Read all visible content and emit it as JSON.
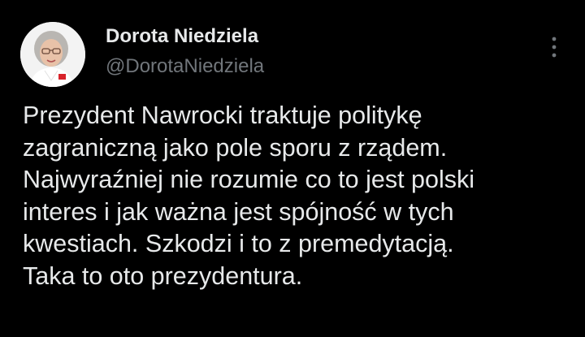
{
  "author": {
    "display_name": "Dorota Niedziela",
    "handle": "@DorotaNiedziela",
    "avatar_icon": "profile-photo"
  },
  "menu": {
    "icon": "more-vertical-icon"
  },
  "tweet": {
    "text": "Prezydent Nawrocki traktuje politykę\nzagraniczną jako pole sporu z rządem.\nNajwyraźniej nie rozumie co to jest polski\ninteres i jak ważna jest spójność w tych\nkwestiach. Szkodzi i to z premedytacją.\nTaka to oto prezydentura."
  },
  "colors": {
    "background": "#000000",
    "text_primary": "#e7e9ea",
    "text_secondary": "#71767b"
  }
}
